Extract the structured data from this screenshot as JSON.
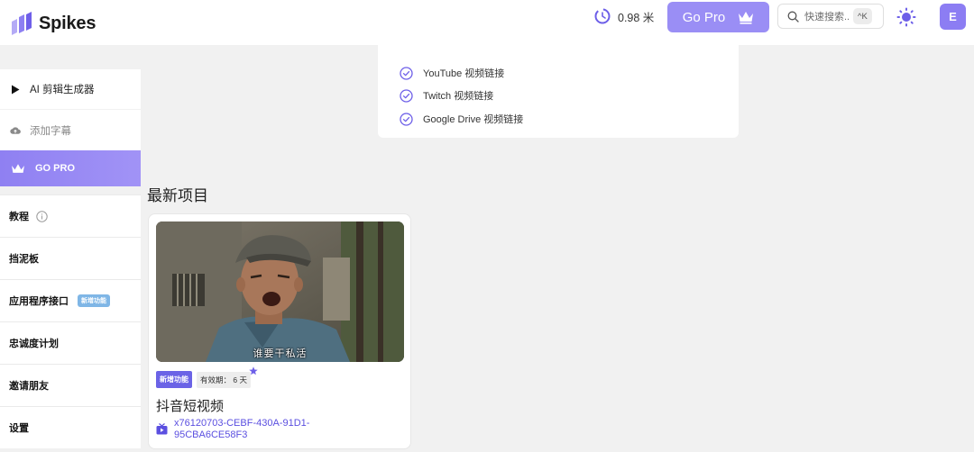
{
  "colors": {
    "accent": "#8c7df3",
    "link": "#5b4fe0",
    "background": "#f1f1f1"
  },
  "header": {
    "logo_text": "Spikes",
    "credits": "0.98 米",
    "gopro_label": "Go Pro",
    "search_placeholder": "快速搜索...",
    "search_shortcut": "^K",
    "avatar_letter": "E",
    "theme_icon": "sun-icon"
  },
  "sidebar": {
    "ai_clip": "AI 剪辑生成器",
    "add_subtitles": "添加字幕",
    "go_pro": "GO PRO",
    "items": [
      {
        "label": "教程",
        "icon": "info-icon"
      },
      {
        "label": "挡泥板"
      },
      {
        "label": "应用程序接口",
        "badge": "新增功能"
      },
      {
        "label": "忠诚度计划"
      },
      {
        "label": "邀请朋友"
      },
      {
        "label": "设置"
      }
    ]
  },
  "feature_card": {
    "items": [
      "YouTube 视频链接",
      "Twitch 视频链接",
      "Google Drive 视频链接"
    ]
  },
  "recent": {
    "title": "最新项目",
    "project": {
      "subtitle": "谁要干私活",
      "tag_new": "新增功能",
      "tag_expiry": "有效期： 6 天",
      "name": "抖音短视频",
      "id": "x76120703-CEBF-430A-91D1-95CBA6CE58F3"
    }
  }
}
